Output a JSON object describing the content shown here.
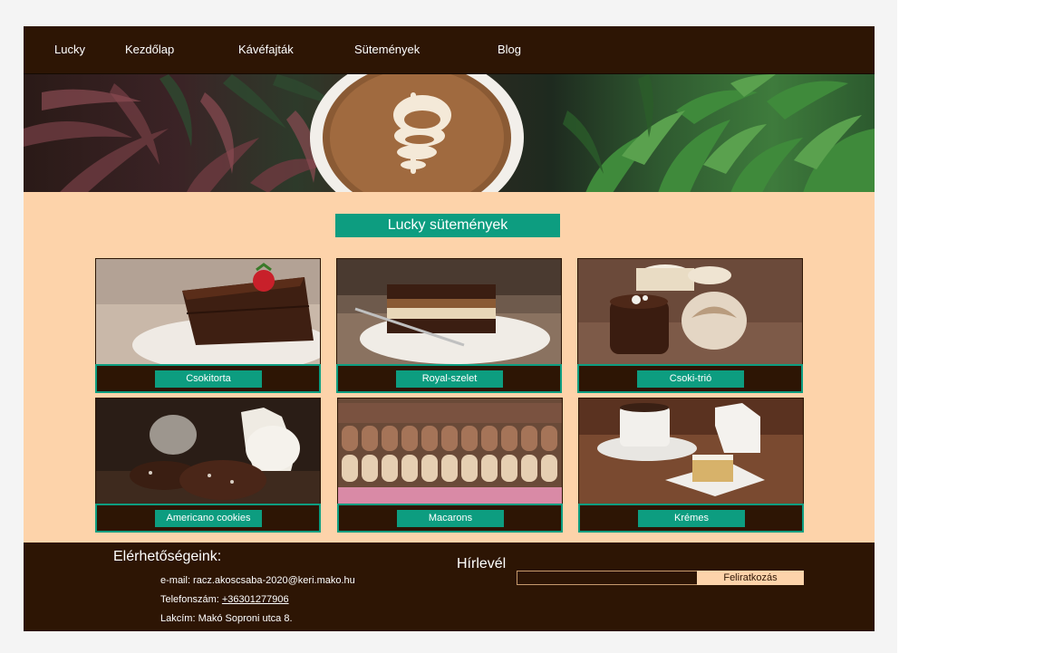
{
  "nav": {
    "brand": "Lucky",
    "items": [
      "Kezdőlap",
      "Kávéfajták",
      "Sütemények",
      "Blog"
    ]
  },
  "hero": {
    "image": "coffee-latte-art-with-plants"
  },
  "section": {
    "title": "Lucky sütemények"
  },
  "products": [
    {
      "label": "Csokitorta",
      "image": "chocolate-cake-with-strawberry"
    },
    {
      "label": "Royal-szelet",
      "image": "layered-cake-slice"
    },
    {
      "label": "Csoki-trió",
      "image": "chocolate-pralines"
    },
    {
      "label": "Americano cookies",
      "image": "chocolate-cookies-with-milk"
    },
    {
      "label": "Macarons",
      "image": "macarons-rows"
    },
    {
      "label": "Krémes",
      "image": "coffee-and-cake"
    }
  ],
  "footer": {
    "contact_title": "Elérhetőségeink:",
    "email_line": "e-mail: racz.akoscsaba-2020@keri.mako.hu",
    "phone_label": "Telefonszám:",
    "phone": "+36301277906",
    "address_line": "Lakcím: Makó Soproni utca 8.",
    "newsletter_title": "Hírlevél",
    "newsletter_input_value": "",
    "subscribe_label": "Feliratkozás"
  },
  "colors": {
    "dark_brown": "#2d1504",
    "peach": "#fdd3aa",
    "teal": "#0d9d80"
  }
}
